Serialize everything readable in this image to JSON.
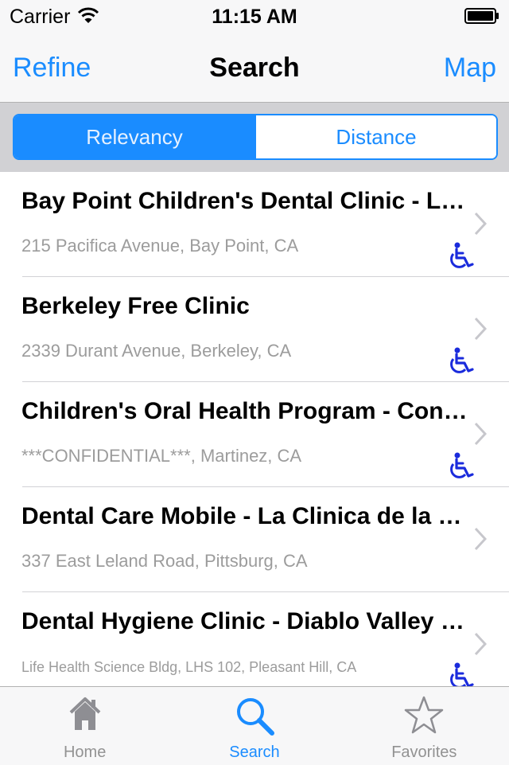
{
  "status_bar": {
    "carrier": "Carrier",
    "time": "11:15 AM"
  },
  "nav": {
    "left": "Refine",
    "title": "Search",
    "right": "Map"
  },
  "sort": {
    "options": [
      "Relevancy",
      "Distance"
    ],
    "selected": "Relevancy"
  },
  "results": [
    {
      "name": "Bay Point Children's Dental Clinic - La Clinica de la Raza",
      "address": "215 Pacifica Avenue, Bay Point, CA",
      "accessible": true
    },
    {
      "name": "Berkeley Free Clinic",
      "address": "2339 Durant Avenue, Berkeley, CA",
      "accessible": true
    },
    {
      "name": "Children's Oral Health Program - Contra Costa",
      "address": "***CONFIDENTIAL***, Martinez, CA",
      "accessible": true
    },
    {
      "name": "Dental Care Mobile - La Clinica de la Raza",
      "address": "337 East Leland Road, Pittsburg, CA",
      "accessible": false
    },
    {
      "name": "Dental Hygiene Clinic - Diablo Valley College",
      "address": "Life Health Science Bldg, LHS 102, Pleasant Hill, CA",
      "accessible": true
    }
  ],
  "tabs": [
    {
      "label": "Home",
      "icon": "home-icon",
      "active": false
    },
    {
      "label": "Search",
      "icon": "search-icon",
      "active": true
    },
    {
      "label": "Favorites",
      "icon": "star-icon",
      "active": false
    }
  ],
  "colors": {
    "accent": "#1a8cff",
    "accessibility": "#1a2bdc",
    "subtle_text": "#9c9c9c"
  }
}
